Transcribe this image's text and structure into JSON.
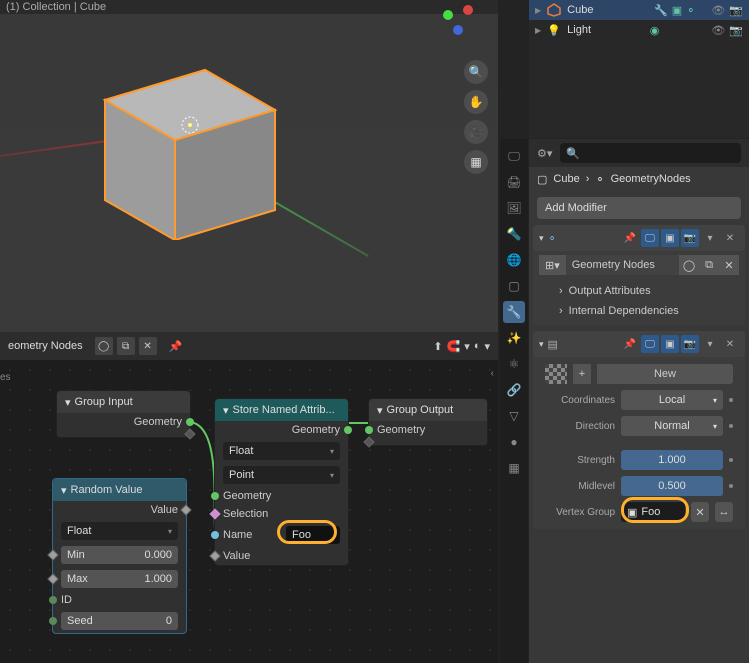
{
  "viewport": {
    "header": "(1) Collection | Cube"
  },
  "outliner": {
    "items": [
      {
        "name": "Cube",
        "selected": true,
        "icon": "mesh"
      },
      {
        "name": "Light",
        "selected": false,
        "icon": "light"
      }
    ]
  },
  "properties": {
    "breadcrumb": {
      "object": "Cube",
      "modifier": "GeometryNodes"
    },
    "add_modifier": "Add Modifier",
    "geo_nodes": {
      "id_label": "Geometry Nodes",
      "outputs_label": "Output Attributes",
      "deps_label": "Internal Dependencies"
    },
    "displace": {
      "new": "New",
      "coords_label": "Coordinates",
      "coords_value": "Local",
      "direction_label": "Direction",
      "direction_value": "Normal",
      "strength_label": "Strength",
      "strength_value": "1.000",
      "midlevel_label": "Midlevel",
      "midlevel_value": "0.500",
      "vgroup_label": "Vertex Group",
      "vgroup_value": "Foo"
    }
  },
  "node_editor": {
    "title": "eometry Nodes",
    "side_label": "es",
    "nodes": {
      "group_input": {
        "title": "Group Input",
        "geometry": "Geometry"
      },
      "random_value": {
        "title": "Random Value",
        "value": "Value",
        "type": "Float",
        "min_label": "Min",
        "min_value": "0.000",
        "max_label": "Max",
        "max_value": "1.000",
        "id": "ID",
        "seed_label": "Seed",
        "seed_value": "0"
      },
      "store_named": {
        "title": "Store Named Attrib...",
        "geometry": "Geometry",
        "type": "Float",
        "domain": "Point",
        "geo_in": "Geometry",
        "selection": "Selection",
        "name_label": "Name",
        "name_value": "Foo",
        "value": "Value"
      },
      "group_output": {
        "title": "Group Output",
        "geometry": "Geometry"
      }
    }
  }
}
